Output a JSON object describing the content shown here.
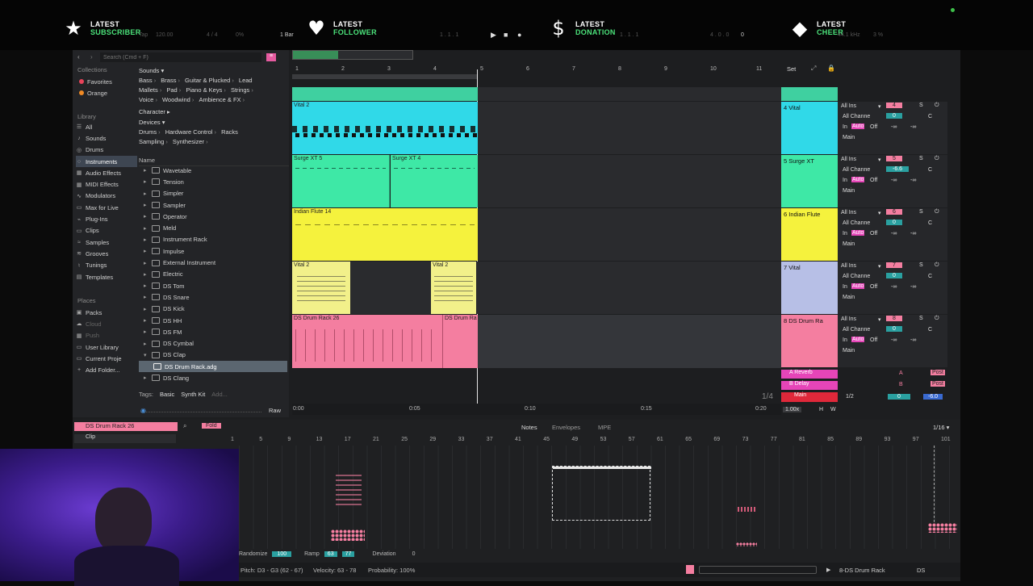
{
  "overlay": {
    "alerts": [
      {
        "icon": "star-icon",
        "line1": "LATEST",
        "line2": "SUBSCRIBER"
      },
      {
        "icon": "heart-icon",
        "line1": "LATEST",
        "line2": "FOLLOWER"
      },
      {
        "icon": "dollar-icon",
        "line1": "LATEST",
        "line2": "DONATION"
      },
      {
        "icon": "diamond-icon",
        "line1": "LATEST",
        "line2": "CHEER"
      }
    ],
    "accent": "#4be27a"
  },
  "transport": {
    "tap": "Tap",
    "tempo": "120.00",
    "meter": "4 / 4",
    "percent": "0%",
    "quant": "1 Bar",
    "pos": "1 . 1 . 1",
    "pos2": "1 . 1 . 1",
    "loop_len": "4 . 0 . 0",
    "cpu": "0",
    "khz": "44.1 kHz",
    "cpu_pct": "3 %"
  },
  "browser": {
    "search_placeholder": "Search (Cmd + F)",
    "collections_h": "Collections",
    "collections": [
      {
        "label": "Favorites",
        "color": "#e8435a"
      },
      {
        "label": "Orange",
        "color": "#f08a24"
      }
    ],
    "library_h": "Library",
    "library": [
      "All",
      "Sounds",
      "Drums",
      "Instruments",
      "Audio Effects",
      "MIDI Effects",
      "Modulators",
      "Max for Live",
      "Plug-Ins",
      "Clips",
      "Samples",
      "Grooves",
      "Tunings",
      "Templates"
    ],
    "places_h": "Places",
    "places": [
      "Packs",
      "Cloud",
      "Push",
      "User Library",
      "Current Proje",
      "Add Folder..."
    ],
    "sounds_h": "Sounds ▾",
    "sounds_tags": [
      [
        "Bass",
        "Brass",
        "Guitar & Plucked",
        "Lead"
      ],
      [
        "Mallets",
        "Pad",
        "Piano & Keys",
        "Strings"
      ],
      [
        "Voice",
        "Woodwind",
        "Ambience & FX"
      ]
    ],
    "character_h": "Character ▸",
    "devices_h": "Devices ▾",
    "devices_tags": [
      [
        "Drums",
        "Hardware Control",
        "Racks"
      ],
      [
        "Sampling",
        "Synthesizer"
      ]
    ],
    "name_h": "Name",
    "files": [
      "Wavetable",
      "Tension",
      "Simpler",
      "Sampler",
      "Operator",
      "Meld",
      "Instrument Rack",
      "Impulse",
      "External Instrument",
      "Electric",
      "DS Tom",
      "DS Snare",
      "DS Kick",
      "DS HH",
      "DS FM",
      "DS Cymbal",
      "DS Clap",
      "DS Drum Rack.adg",
      "DS Clang"
    ],
    "tags_label": "Tags:",
    "tags": [
      "Basic",
      "Synth Kit",
      "Add..."
    ],
    "raw": "Raw"
  },
  "arrangement": {
    "bars": [
      "1",
      "2",
      "3",
      "4",
      "5",
      "6",
      "7",
      "8",
      "9",
      "10",
      "11"
    ],
    "set_label": "Set",
    "time_labels": [
      "0:00",
      "0:05",
      "0:10",
      "0:15",
      "0:20"
    ],
    "quant": "1/4",
    "clips": [
      "Vital 2",
      "Surge XT 5",
      "Surge XT 4",
      "Indian Flute 14",
      "Vital 2",
      "Vital 2",
      "DS Drum Rack 26",
      "DS Drum Ra"
    ]
  },
  "mixer": {
    "tracks": [
      {
        "name": "4 Vital",
        "color": "#30d9e8",
        "in": "All Ins",
        "ch": "All Channe",
        "num": "4",
        "vol": "0",
        "pan": "C"
      },
      {
        "name": "5 Surge XT",
        "color": "#3ee8a6",
        "in": "All Ins",
        "ch": "All Channe",
        "num": "5",
        "vol": "-6.6",
        "pan": "C"
      },
      {
        "name": "6 Indian Flute",
        "color": "#f5f23d",
        "in": "All Ins",
        "ch": "All Channe",
        "num": "6",
        "vol": "0",
        "pan": "C"
      },
      {
        "name": "7 Vital",
        "color": "#b7bfe6",
        "in": "All Ins",
        "ch": "All Channe",
        "num": "7",
        "vol": "0",
        "pan": "C"
      },
      {
        "name": "8 DS Drum Ra",
        "color": "#f47ea0",
        "in": "All Ins",
        "ch": "All Channe",
        "num": "8",
        "vol": "0",
        "pan": "C"
      }
    ],
    "monitor": [
      "In",
      "Auto",
      "Off"
    ],
    "out": "Main",
    "returns": [
      {
        "name": "A Reverb",
        "letter": "A"
      },
      {
        "name": "B Delay",
        "letter": "B"
      }
    ],
    "master": {
      "name": "Main",
      "quant": "1/2",
      "vol": "0",
      "db": "-6.0"
    },
    "zoom": "1.00x",
    "hw": [
      "H",
      "W"
    ]
  },
  "clipview": {
    "clip_name": "DS Drum Rack 26",
    "fold": "Fold",
    "clip_tab": "Clip",
    "tabs": [
      "Notes",
      "Envelopes",
      "MPE"
    ],
    "grid": "1/16 ▾",
    "ruler": [
      "1",
      "5",
      "9",
      "13",
      "17",
      "21",
      "25",
      "29",
      "33",
      "37",
      "41",
      "45",
      "49",
      "53",
      "57",
      "61",
      "65",
      "69",
      "73",
      "77",
      "81",
      "85",
      "89",
      "93",
      "97",
      "101"
    ],
    "bottom": {
      "randomize": "Randomize",
      "rand_val": "100",
      "ramp": "Ramp",
      "ramp_a": "63",
      "ramp_b": "77",
      "deviation": "Deviation",
      "dev_val": "0"
    }
  },
  "status": {
    "pitch": "Pitch: D3 - G3 (62 - 67)",
    "velocity": "Velocity: 63 - 78",
    "prob": "Probability: 100%",
    "track": "8-DS Drum Rack",
    "ds": "DS"
  }
}
